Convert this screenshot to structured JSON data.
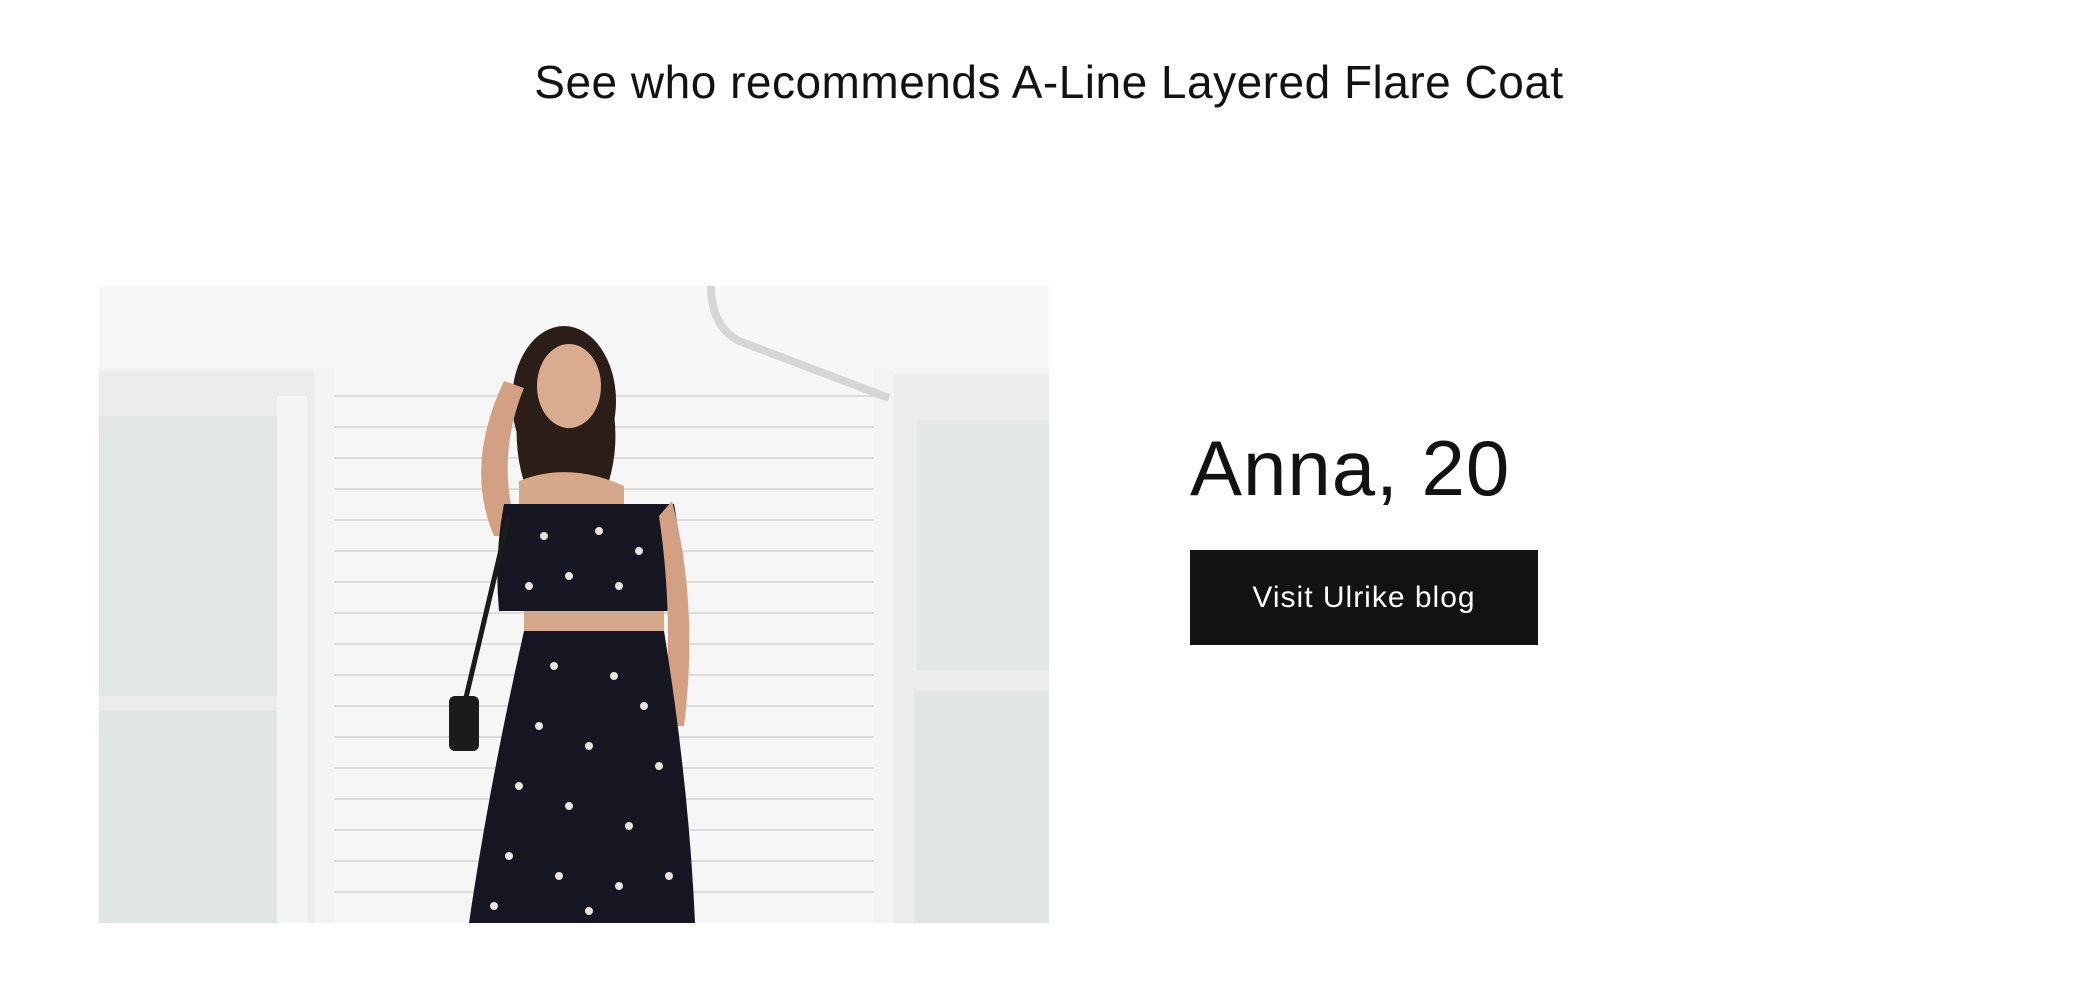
{
  "section": {
    "heading": "See who recommends A-Line Layered Flare Coat"
  },
  "recommender": {
    "name_age": "Anna, 20",
    "button_label": "Visit Ulrike blog",
    "button_color": "#121212"
  }
}
